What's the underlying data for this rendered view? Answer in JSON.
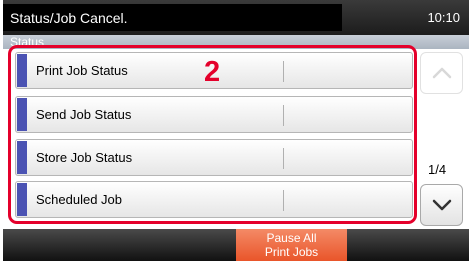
{
  "header": {
    "title": "Status/Job Cancel.",
    "time": "10:10"
  },
  "breadcrumb": {
    "label": "Status"
  },
  "rows": [
    {
      "label": "Print Job Status"
    },
    {
      "label": "Send Job Status"
    },
    {
      "label": "Store Job Status"
    },
    {
      "label": "Scheduled Job"
    }
  ],
  "callout": "2",
  "pagination": {
    "page": "1/4",
    "up_icon": "chevron-up-icon",
    "down_icon": "chevron-down-icon"
  },
  "footer": {
    "pause_line1": "Pause All",
    "pause_line2": "Print Jobs"
  },
  "colors": {
    "highlight": "#e4002b",
    "row_marker": "#4b53b3",
    "pause_button": "#ee6a40"
  }
}
